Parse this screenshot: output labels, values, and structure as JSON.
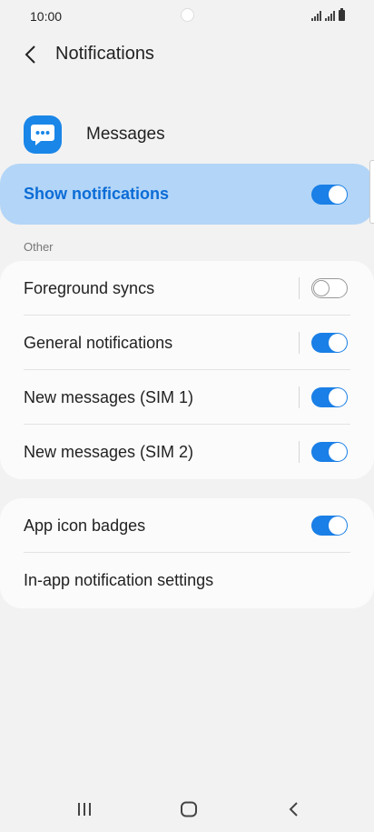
{
  "status_bar": {
    "time": "10:00"
  },
  "header": {
    "title": "Notifications"
  },
  "app": {
    "name": "Messages"
  },
  "show_notifications": {
    "label": "Show notifications",
    "enabled": true
  },
  "section": {
    "label": "Other"
  },
  "other_items": [
    {
      "label": "Foreground syncs",
      "enabled": false
    },
    {
      "label": "General notifications",
      "enabled": true
    },
    {
      "label": "New messages (SIM 1)",
      "enabled": true
    },
    {
      "label": "New messages (SIM 2)",
      "enabled": true
    }
  ],
  "badges": {
    "label": "App icon badges",
    "enabled": true
  },
  "in_app": {
    "label": "In-app notification settings"
  },
  "colors": {
    "accent": "#1a7fe6",
    "highlight": "#b3d5f7",
    "background": "#f2f2f2"
  },
  "icons": {
    "back": "chevron-left-icon",
    "app": "chat-bubble-icon",
    "nav_recents": "recents-icon",
    "nav_home": "home-icon",
    "nav_back": "back-icon"
  }
}
